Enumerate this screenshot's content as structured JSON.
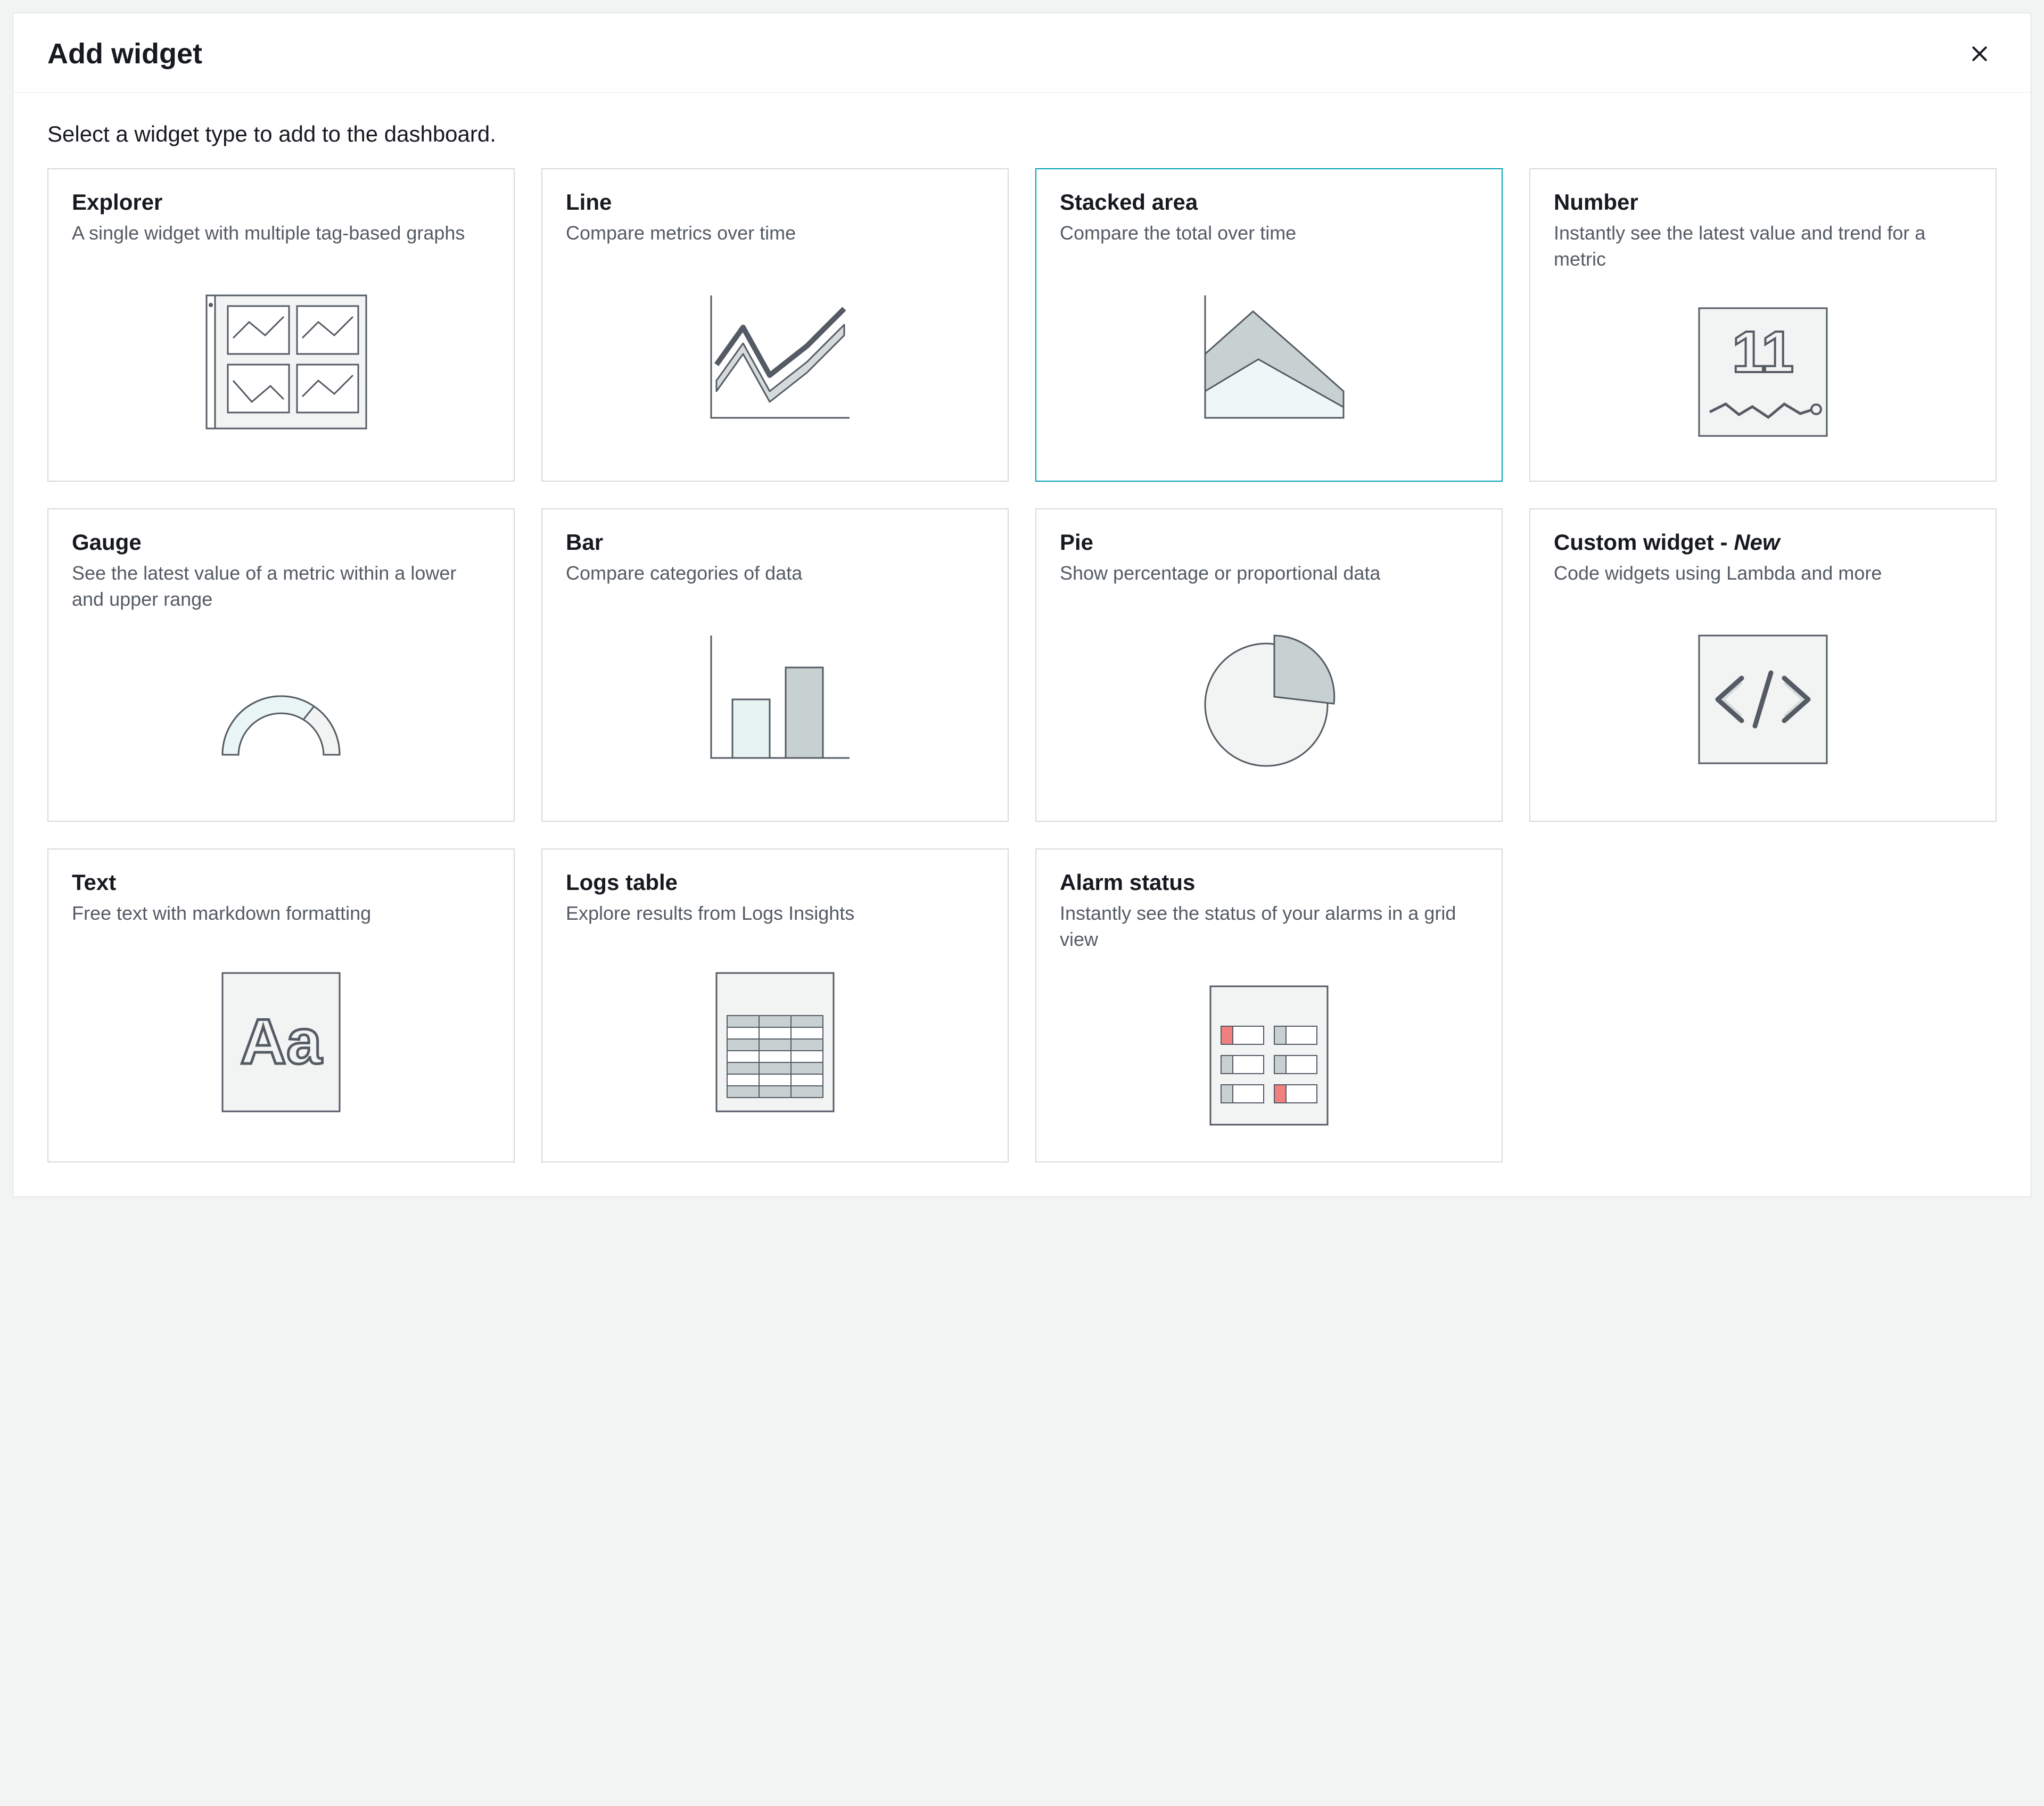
{
  "modal": {
    "title": "Add widget",
    "prompt": "Select a widget type to add to the dashboard.",
    "selected_index": 2,
    "widgets": [
      {
        "id": "explorer",
        "title": "Explorer",
        "desc": "A single widget with multiple tag-based graphs"
      },
      {
        "id": "line",
        "title": "Line",
        "desc": "Compare metrics over time"
      },
      {
        "id": "stacked-area",
        "title": "Stacked area",
        "desc": "Compare the total over time"
      },
      {
        "id": "number",
        "title": "Number",
        "desc": "Instantly see the latest value and trend for a metric"
      },
      {
        "id": "gauge",
        "title": "Gauge",
        "desc": "See the latest value of a metric within a lower and upper range"
      },
      {
        "id": "bar",
        "title": "Bar",
        "desc": "Compare categories of data"
      },
      {
        "id": "pie",
        "title": "Pie",
        "desc": "Show percentage or proportional data"
      },
      {
        "id": "custom",
        "title": "Custom widget - ",
        "title_suffix": "New",
        "desc": "Code widgets using Lambda and more"
      },
      {
        "id": "text",
        "title": "Text",
        "desc": "Free text with markdown formatting"
      },
      {
        "id": "logs-table",
        "title": "Logs table",
        "desc": "Explore results from Logs Insights"
      },
      {
        "id": "alarm-status",
        "title": "Alarm status",
        "desc": "Instantly see the status of your alarms in a grid view"
      }
    ]
  }
}
